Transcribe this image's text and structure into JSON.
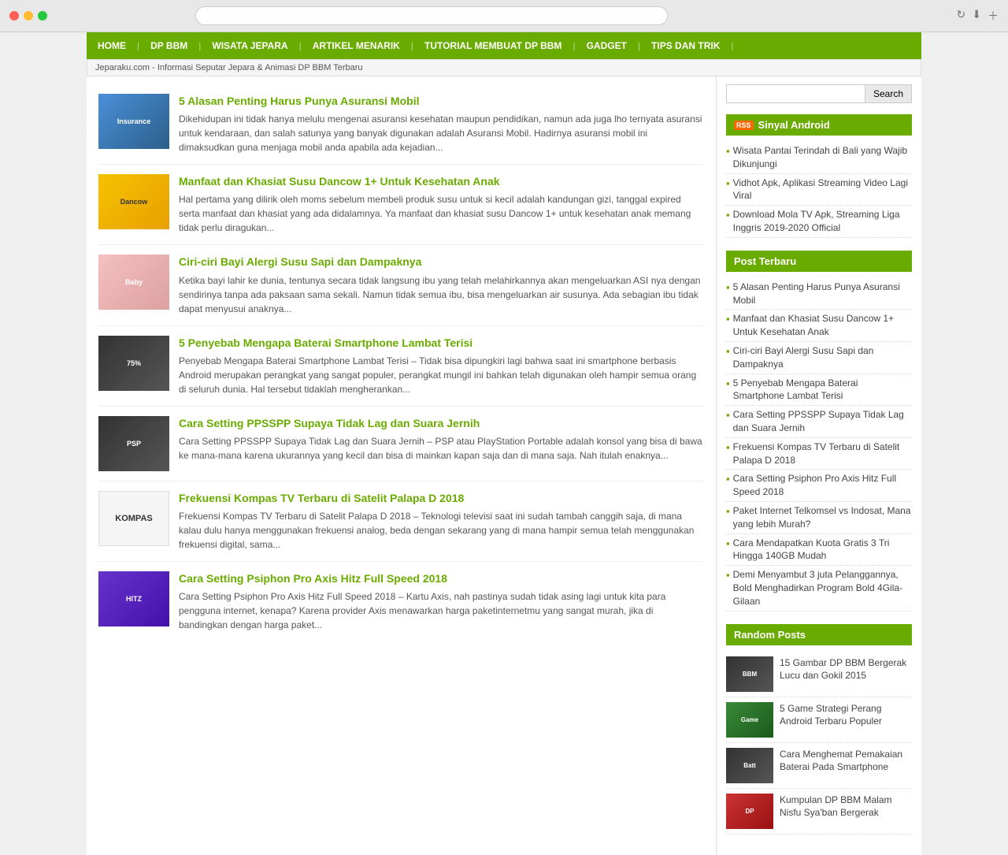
{
  "browser": {
    "url": ""
  },
  "nav": {
    "items": [
      {
        "label": "HOME",
        "id": "home"
      },
      {
        "label": "DP BBM",
        "id": "dp-bbm"
      },
      {
        "label": "WISATA JEPARA",
        "id": "wisata-jepara"
      },
      {
        "label": "ARTIKEL MENARIK",
        "id": "artikel-menarik"
      },
      {
        "label": "TUTORIAL MEMBUAT DP BBM",
        "id": "tutorial"
      },
      {
        "label": "GADGET",
        "id": "gadget"
      },
      {
        "label": "TIPS DAN TRIK",
        "id": "tips-dan-trik"
      }
    ]
  },
  "breadcrumb": "Jeparaku.com - Informasi Seputar Jepara & Animasi DP BBM Terbaru",
  "articles": [
    {
      "id": "article-1",
      "title": "5 Alasan Penting Harus Punya Asuransi Mobil",
      "excerpt": "Dikehidupan ini tidak hanya melulu mengenai asuransi kesehatan maupun pendidikan, namun ada juga lho ternyata asuransi untuk kendaraan, dan salah satunya yang banyak digunakan adalah Asuransi Mobil. Hadirnya asuransi mobil ini dimaksudkan guna menjaga mobil anda apabila ada kejadian...",
      "thumb_label": "Insurance",
      "thumb_color": "blue"
    },
    {
      "id": "article-2",
      "title": "Manfaat dan Khasiat Susu Dancow 1+ Untuk Kesehatan Anak",
      "excerpt": "Hal pertama yang dilirik oleh moms sebelum membeli produk susu untuk si kecil adalah kandungan gizi, tanggal expired serta manfaat dan khasiat yang ada didalamnya. Ya manfaat dan khasiat susu Dancow 1+ untuk kesehatan anak memang tidak perlu diragukan...",
      "thumb_label": "Dancow",
      "thumb_color": "yellow"
    },
    {
      "id": "article-3",
      "title": "Ciri-ciri Bayi Alergi Susu Sapi dan Dampaknya",
      "excerpt": "Ketika bayi lahir ke dunia, tentunya secara tidak langsung ibu yang telah melahirkannya akan mengeluarkan ASI nya dengan sendirinya tanpa ada paksaan sama sekali. Namun tidak semua ibu, bisa mengeluarkan air susunya. Ada sebagian ibu tidak dapat menyusui anaknya...",
      "thumb_label": "Baby",
      "thumb_color": "pink"
    },
    {
      "id": "article-4",
      "title": "5 Penyebab Mengapa Baterai Smartphone Lambat Terisi",
      "excerpt": "Penyebab Mengapa Baterai Smartphone Lambat Terisi – Tidak bisa dipungkiri lagi bahwa saat ini smartphone berbasis Android merupakan perangkat yang sangat populer, perangkat mungil ini bahkan telah digunakan oleh hampir semua orang di seluruh dunia. Hal tersebut tidaklah mengherankan...",
      "thumb_label": "75%",
      "thumb_color": "dark"
    },
    {
      "id": "article-5",
      "title": "Cara Setting PPSSPP Supaya Tidak Lag dan Suara Jernih",
      "excerpt": "Cara Setting PPSSPP Supaya Tidak Lag dan Suara Jernih – PSP atau PlayStation Portable adalah konsol yang bisa di bawa ke mana-mana karena ukurannya yang kecil dan bisa di mainkan kapan saja dan di mana saja. Nah itulah enaknya...",
      "thumb_label": "PSP",
      "thumb_color": "dark"
    },
    {
      "id": "article-6",
      "title": "Frekuensi Kompas TV Terbaru di Satelit Palapa D 2018",
      "excerpt": "Frekuensi Kompas TV Terbaru di Satelit Palapa D 2018 – Teknologi televisi saat ini sudah tambah canggih saja, di mana kalau dulu hanya menggunakan frekuensi analog, beda dengan sekarang yang di mana hampir semua telah menggunakan frekuensi digital, sama...",
      "thumb_label": "KOMPAS",
      "thumb_color": "white"
    },
    {
      "id": "article-7",
      "title": "Cara Setting Psiphon Pro Axis Hitz Full Speed 2018",
      "excerpt": "Cara Setting Psiphon Pro Axis Hitz Full Speed 2018 – Kartu Axis, nah pastinya sudah tidak asing lagi untuk kita para pengguna internet, kenapa? Karena provider Axis menawarkan harga paketinternetmu yang sangat murah, jika di bandingkan dengan harga paket...",
      "thumb_label": "HITZ",
      "thumb_color": "purple"
    }
  ],
  "sidebar": {
    "search": {
      "placeholder": "",
      "button_label": "Search"
    },
    "sinyal_android": {
      "title": "Sinyal Android",
      "items": [
        "Wisata Pantai Terindah di Bali yang Wajib Dikunjungi",
        "Vidhot Apk, Aplikasi Streaming Video Lagi Viral",
        "Download Mola TV Apk, Streaming Liga Inggris 2019-2020 Official"
      ]
    },
    "post_terbaru": {
      "title": "Post Terbaru",
      "items": [
        "5 Alasan Penting Harus Punya Asuransi Mobil",
        "Manfaat dan Khasiat Susu Dancow 1+ Untuk Kesehatan Anak",
        "Ciri-ciri Bayi Alergi Susu Sapi dan Dampaknya",
        "5 Penyebab Mengapa Baterai Smartphone Lambat Terisi",
        "Cara Setting PPSSPP Supaya Tidak Lag dan Suara Jernih",
        "Frekuensi Kompas TV Terbaru di Satelit Palapa D 2018",
        "Cara Setting Psiphon Pro Axis Hitz Full Speed 2018",
        "Paket Internet Telkomsel vs Indosat, Mana yang lebih Murah?",
        "Cara Mendapatkan Kuota Gratis 3 Tri Hingga 140GB Mudah",
        "Demi Menyambut 3 juta Pelanggannya, Bold Menghadirkan Program Bold 4Gila-Gilaan"
      ]
    },
    "random_posts": {
      "title": "Random Posts",
      "items": [
        {
          "title": "15 Gambar DP BBM Bergerak Lucu dan Gokil 2015",
          "thumb_color": "dark",
          "thumb_label": "BBM"
        },
        {
          "title": "5 Game Strategi Perang Android Terbaru Populer",
          "thumb_color": "green",
          "thumb_label": "Game"
        },
        {
          "title": "Cara Menghemat Pemakaian Baterai Pada Smartphone",
          "thumb_color": "dark",
          "thumb_label": "Batt"
        },
        {
          "title": "Kumpulan DP BBM Malam Nisfu Sya'ban Bergerak",
          "thumb_color": "red",
          "thumb_label": "DP"
        }
      ]
    }
  },
  "colors": {
    "nav_bg": "#6aab00",
    "accent": "#6aab00"
  }
}
